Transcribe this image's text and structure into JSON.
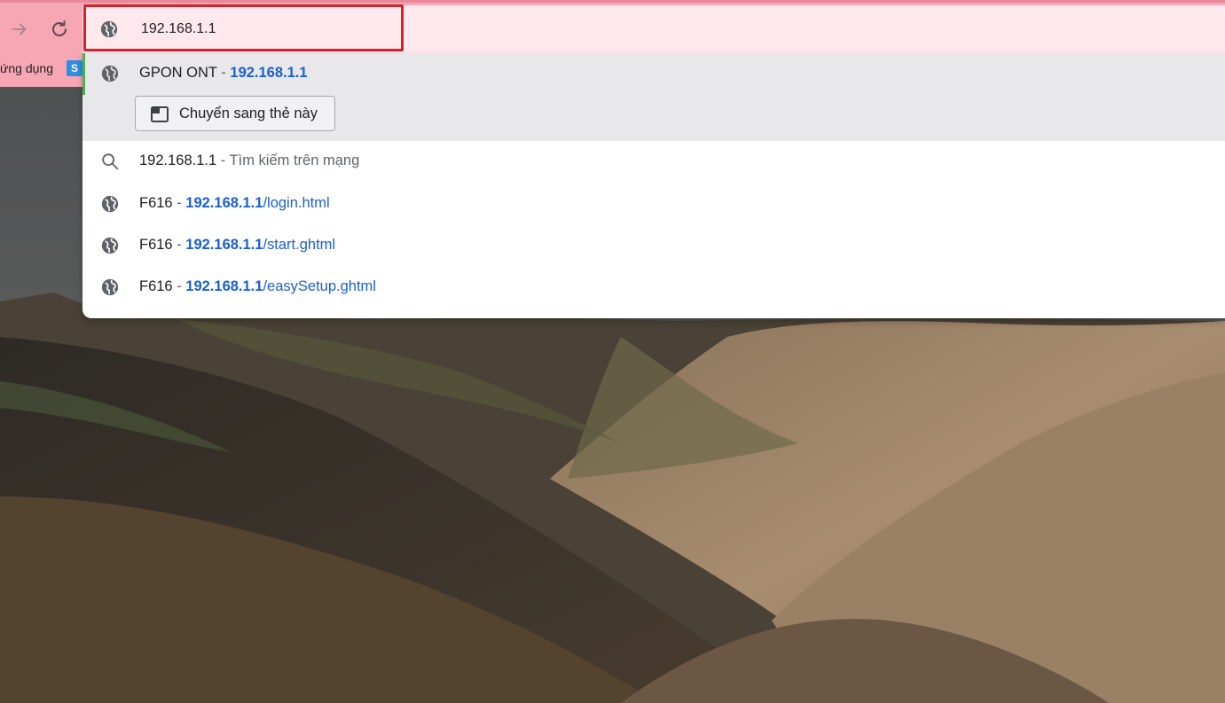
{
  "toolbar": {
    "forward_icon": "arrow-right-icon",
    "reload_icon": "reload-icon"
  },
  "bookmarks_bar": {
    "apps_label": "ứng dụng",
    "bookmark_favicon_letter": "S"
  },
  "omnibox": {
    "value": "192.168.1.1",
    "icon": "globe-icon"
  },
  "suggestions": [
    {
      "icon": "globe-icon",
      "title": "GPON ONT",
      "separator": " - ",
      "url_bold": "192.168.1.1",
      "url_rest": "",
      "selected": true,
      "action_button": {
        "label": "Chuyển sang thẻ này",
        "icon": "switch-tab-icon"
      }
    },
    {
      "icon": "search-icon",
      "title": "192.168.1.1",
      "separator": " - ",
      "secondary": "Tìm kiếm trên mạng"
    },
    {
      "icon": "globe-icon",
      "title": "F616",
      "separator": " - ",
      "url_bold": "192.168.1.1",
      "url_rest": "/login.html"
    },
    {
      "icon": "globe-icon",
      "title": "F616",
      "separator": " - ",
      "url_bold": "192.168.1.1",
      "url_rest": "/start.ghtml"
    },
    {
      "icon": "globe-icon",
      "title": "F616",
      "separator": " - ",
      "url_bold": "192.168.1.1",
      "url_rest": "/easySetup.ghtml"
    }
  ],
  "colors": {
    "toolbar_bg": "#f7a6b4",
    "omnibox_bg": "#ffe9ee",
    "url_blue": "#1a5fd0",
    "highlight_red": "#d2232a",
    "selected_row_bg": "#e8e8ea"
  }
}
